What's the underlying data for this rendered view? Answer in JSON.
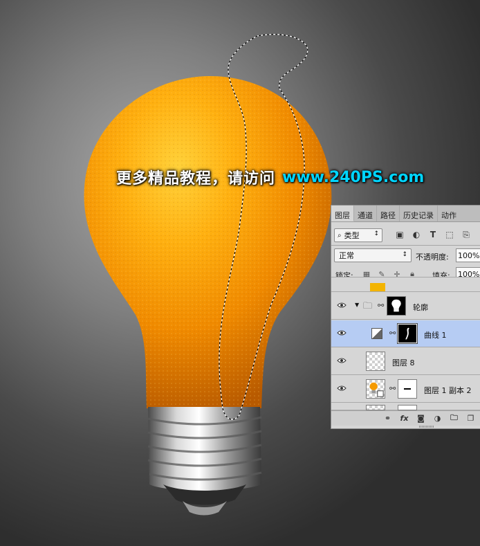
{
  "watermark": {
    "text_cn": "更多精品教程，请访问",
    "url": "www.240PS.com"
  },
  "panel": {
    "tabs": [
      "图层",
      "通道",
      "路径",
      "历史记录",
      "动作"
    ],
    "active_tab": "图层",
    "filter_kind": "类型",
    "blend_mode": "正常",
    "opacity_label": "不透明度:",
    "opacity_value": "100%",
    "lock_label": "锁定:",
    "fill_label": "填充:",
    "fill_value": "100%",
    "layers": [
      {
        "name": "轮廓",
        "type": "group",
        "expanded": true,
        "visible": true,
        "selected": false
      },
      {
        "name": "曲线 1",
        "type": "adjustment-curves",
        "visible": true,
        "selected": true
      },
      {
        "name": "图层 8",
        "type": "pixel",
        "visible": true,
        "selected": false
      },
      {
        "name": "图层 1 副本 2",
        "type": "smart-object",
        "visible": true,
        "selected": false
      }
    ],
    "bottom_icons": [
      "link-icon",
      "fx-icon",
      "add-mask-icon",
      "adjustment-icon",
      "new-group-icon",
      "new-layer-icon"
    ]
  },
  "colors": {
    "orange": "#f59a00",
    "selection_highlight": "#b6ccf3",
    "watermark_url": "#00d5ff"
  }
}
